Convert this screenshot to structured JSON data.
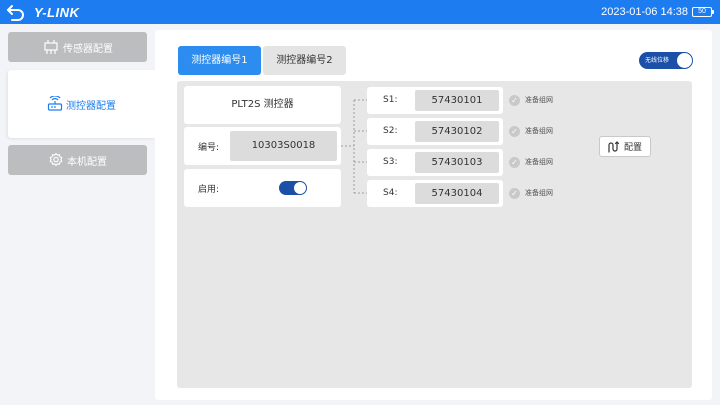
{
  "header": {
    "logo": "Y-LINK",
    "datetime": "2023-01-06 14:38",
    "battery": "50"
  },
  "sidebar": {
    "items": [
      {
        "label": "传感器配置",
        "icon": "sensor-icon"
      },
      {
        "label": "测控器配置",
        "icon": "router-icon"
      },
      {
        "label": "本机配置",
        "icon": "gear-icon"
      }
    ]
  },
  "main": {
    "tabs": [
      {
        "label": "测控器编号1"
      },
      {
        "label": "测控器编号2"
      }
    ],
    "wireless_toggle_label": "无线位移",
    "controller_name": "PLT2S 测控器",
    "id_label": "编号:",
    "id_value": "10303S0018",
    "enable_label": "启用:",
    "sensors": [
      {
        "label": "S1:",
        "value": "57430101",
        "status": "准备组网"
      },
      {
        "label": "S2:",
        "value": "57430102",
        "status": "准备组网"
      },
      {
        "label": "S3:",
        "value": "57430103",
        "status": "准备组网"
      },
      {
        "label": "S4:",
        "value": "57430104",
        "status": "准备组网"
      }
    ],
    "config_button": "配置"
  },
  "colors": {
    "accent": "#1d7df0",
    "toggle": "#1b4fa8",
    "sidebar_inactive": "#bcbdbf"
  }
}
